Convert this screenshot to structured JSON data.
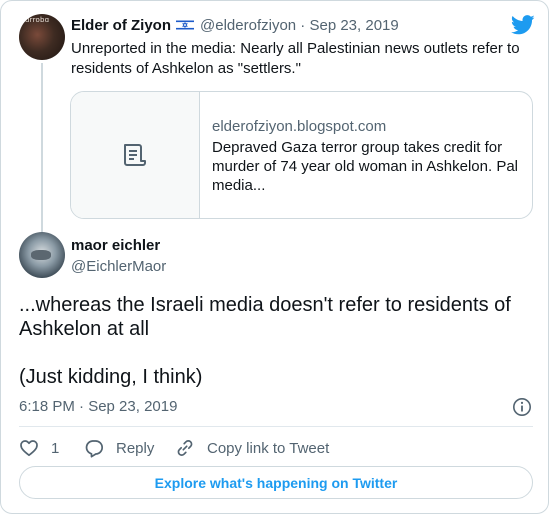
{
  "parent_tweet": {
    "avatar_text": "ɑrrobɑ",
    "author_name": "Elder of Ziyon",
    "author_handle": "@elderofziyon",
    "separator": "·",
    "date": "Sep 23, 2019",
    "text": "Unreported in the media: Nearly all Palestinian news outlets refer to residents of Ashkelon as \"settlers.\"",
    "link_card": {
      "domain": "elderofziyon.blogspot.com",
      "title": "Depraved Gaza terror group takes credit for murder of 74 year old woman in Ashkelon. Pal media..."
    }
  },
  "main_tweet": {
    "author_name": "maor eichler",
    "author_handle": "@EichlerMaor",
    "text_line1": "...whereas the Israeli media doesn't refer to residents of Ashkelon at all",
    "text_line2": "(Just kidding, I think)",
    "timestamp": "6:18 PM · Sep 23, 2019"
  },
  "actions": {
    "like_count": "1",
    "reply_label": "Reply",
    "copy_link_label": "Copy link to Tweet"
  },
  "explore_button_label": "Explore what's happening on Twitter",
  "colors": {
    "twitter_blue": "#1d9bf0",
    "text_primary": "#0f1419",
    "text_secondary": "#536471",
    "border": "#cfd9de"
  },
  "icons": [
    "twitter-bird-icon",
    "israel-flag-icon",
    "document-icon",
    "info-icon",
    "heart-icon",
    "reply-bubble-icon",
    "link-icon"
  ]
}
